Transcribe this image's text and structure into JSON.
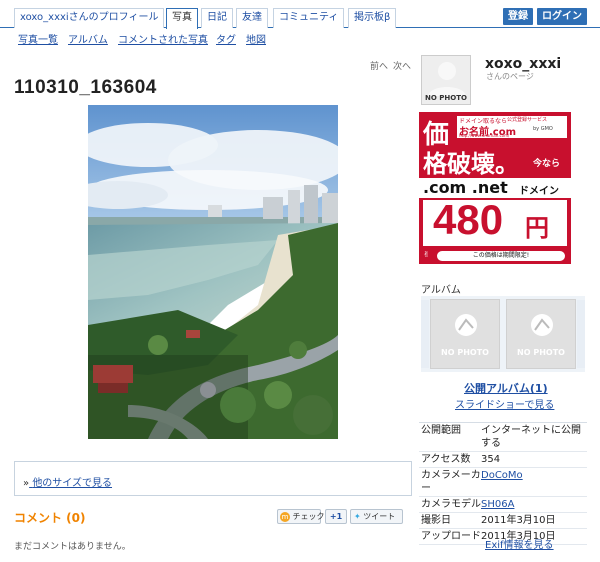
{
  "header": {
    "tabs": [
      {
        "label": "xoxo_xxxiさんのプロフィール"
      },
      {
        "label": "写真"
      },
      {
        "label": "日記"
      },
      {
        "label": "友達"
      },
      {
        "label": "コミュニティ"
      },
      {
        "label": "掲示板β"
      }
    ],
    "active_tab": "写真",
    "register_label": "登録",
    "login_label": "ログイン"
  },
  "subnav": [
    "写真一覧",
    "アルバム",
    "コメントされた写真",
    "タグ",
    "地図"
  ],
  "pager": {
    "prev": "前へ",
    "next": "次へ"
  },
  "photo": {
    "title": "110310_163604"
  },
  "other_sizes": {
    "prefix": "»",
    "label": "他のサイズで見る"
  },
  "comments": {
    "heading": "コメント (0)",
    "empty": "まだコメントはありません。"
  },
  "share": {
    "check": "チェック",
    "plus": "+1",
    "tweet": "ツイート"
  },
  "profile": {
    "username": "xoxo_xxxi",
    "subtitle": "さんのページ",
    "avatar_text": "NO PHOTO"
  },
  "ad": {
    "line1": "価",
    "line1b": "格破壊。",
    "brand": "お名前.com",
    "tagline": "ドメイン取るなら",
    "brand_sub": "公式登録サービス",
    "url": "http://www.onamae.com/",
    "gmo": "by GMO",
    "now": "今なら",
    "domains": ".com .net",
    "domain_word": "ドメイン",
    "price": "480",
    "yen": "円",
    "note": "この価格は期間限定!"
  },
  "album": {
    "label": "アルバム",
    "thumbs": [
      {
        "text": "NO PHOTO"
      },
      {
        "text": "NO PHOTO"
      }
    ],
    "public_link": "公開アルバム(1)",
    "slideshow_link": "スライドショーで見る"
  },
  "info": [
    {
      "key": "公開範囲",
      "value": "インターネットに公開する"
    },
    {
      "key": "アクセス数",
      "value": "354"
    },
    {
      "key": "カメラメーカー",
      "value": "DoCoMo",
      "link": true
    },
    {
      "key": "カメラモデル",
      "value": "SH06A",
      "link": true
    },
    {
      "key": "撮影日",
      "value": "2011年3月10日"
    },
    {
      "key": "アップロード",
      "value": "2011年3月10日"
    }
  ],
  "exif_link": "Exif情報を見る",
  "colors": {
    "brand_blue": "#2f6fb5",
    "link": "#1f4fa3",
    "comment_orange": "#f08300",
    "ad_red": "#c8102e"
  }
}
